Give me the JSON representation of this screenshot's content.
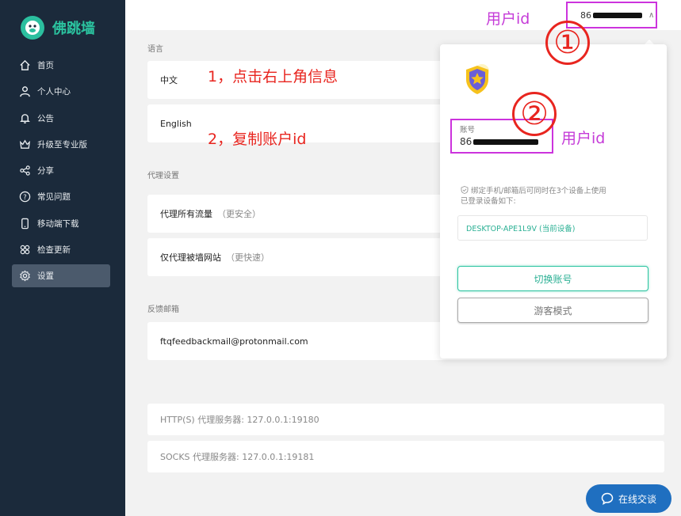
{
  "app": {
    "name": "佛跳墙"
  },
  "sidebar": {
    "items": [
      {
        "label": "首页",
        "icon": "home-icon"
      },
      {
        "label": "个人中心",
        "icon": "user-icon"
      },
      {
        "label": "公告",
        "icon": "bell-icon"
      },
      {
        "label": "升级至专业版",
        "icon": "crown-icon"
      },
      {
        "label": "分享",
        "icon": "share-icon"
      },
      {
        "label": "常见问题",
        "icon": "question-icon"
      },
      {
        "label": "移动端下载",
        "icon": "phone-icon"
      },
      {
        "label": "检查更新",
        "icon": "update-icon"
      },
      {
        "label": "设置",
        "icon": "gear-icon",
        "active": true
      }
    ]
  },
  "topbar": {
    "account_prefix": "86"
  },
  "settings": {
    "language_label": "语言",
    "lang_chinese": "中文",
    "lang_english": "English",
    "proxy_label": "代理设置",
    "proxy_all": "代理所有流量",
    "proxy_all_note": "（更安全）",
    "proxy_blocked": "仅代理被墙网站",
    "proxy_blocked_note": "（更快速）",
    "feedback_label": "反馈邮箱",
    "feedback_email": "ftqfeedbackmail@protonmail.com",
    "http_proxy": "HTTP(S) 代理服务器: 127.0.0.1:19180",
    "socks_proxy": "SOCKS 代理服务器: 127.0.0.1:19181"
  },
  "popup": {
    "account_label": "账号",
    "account_prefix": "86",
    "bind_note_line1": "绑定手机/邮箱后可同时在3个设备上使用",
    "bind_note_line2": "已登录设备如下:",
    "device": "DESKTOP-APE1L9V (当前设备)",
    "switch_account": "切换账号",
    "guest_mode": "游客模式"
  },
  "annotations": {
    "step1": "1，点击右上角信息",
    "step2": "2，复制账户id",
    "user_id_top": "用户id",
    "user_id_popup": "用户id",
    "circle1": "①",
    "circle2": "②"
  },
  "chat": {
    "label": "在线交谈"
  },
  "colors": {
    "sidebar_bg": "#1b2a3b",
    "accent": "#2bc4a0",
    "annotation_red": "#e8251f",
    "annotation_purple": "#c53bd8",
    "chat_blue": "#1f6fc0"
  }
}
